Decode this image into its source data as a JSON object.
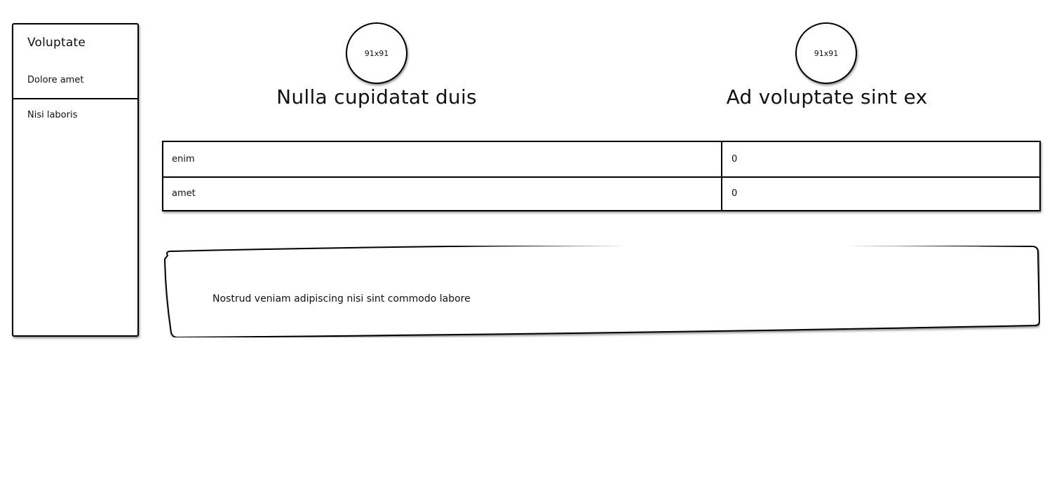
{
  "sidebar": {
    "title": "Voluptate",
    "items": [
      {
        "label": "Dolore amet"
      },
      {
        "label": "Nisi laboris"
      }
    ]
  },
  "cards": [
    {
      "avatar_label": "91x91",
      "heading": "Nulla cupidatat duis"
    },
    {
      "avatar_label": "91x91",
      "heading": "Ad voluptate sint ex"
    }
  ],
  "table": {
    "rows": [
      {
        "key": "enim",
        "value": "0"
      },
      {
        "key": "amet",
        "value": "0"
      }
    ]
  },
  "textbox": {
    "text": "Nostrud veniam adipiscing nisi sint commodo labore"
  }
}
